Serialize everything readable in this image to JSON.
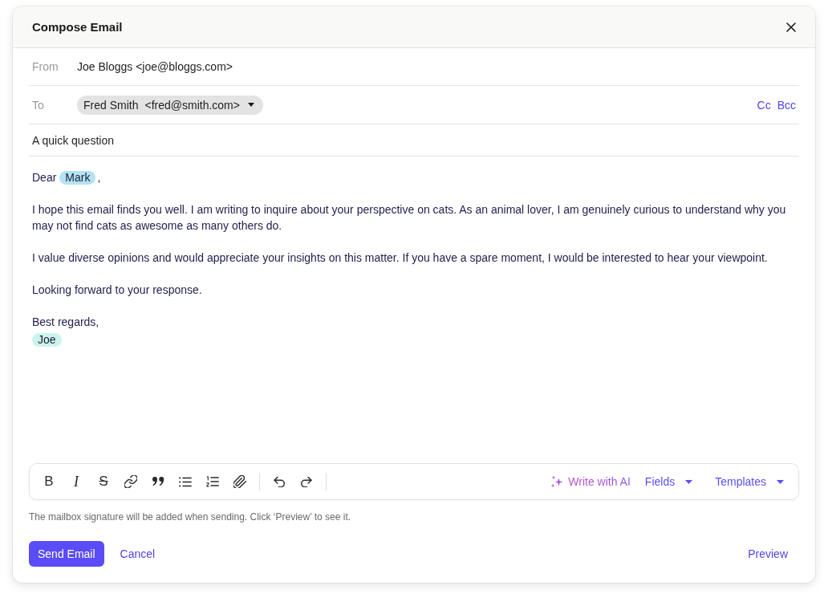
{
  "dialog": {
    "title": "Compose Email"
  },
  "from": {
    "label": "From",
    "value": "Joe Bloggs <joe@bloggs.com>"
  },
  "to": {
    "label": "To",
    "recipients": [
      {
        "name": "Fred Smith",
        "email": "<fred@smith.com>"
      }
    ],
    "links": [
      "Cc",
      "Bcc"
    ]
  },
  "subject": {
    "value": "A quick question"
  },
  "body": {
    "paragraphs": [
      {
        "lines": [
          [
            {
              "kind": "text",
              "text": "Dear"
            },
            {
              "kind": "field",
              "text": "Mark",
              "color": "#b4e3f3"
            },
            {
              "kind": "text",
              "text": ","
            }
          ]
        ]
      },
      {
        "lines": [
          [
            {
              "kind": "text",
              "text": "I hope this email finds you well. I am writing to inquire about your perspective on cats. As an animal lover, I am genuinely curious to understand why you may not find cats as awesome as many others do."
            }
          ]
        ]
      },
      {
        "lines": [
          [
            {
              "kind": "text",
              "text": "I value diverse opinions and would appreciate your insights on this matter. If you have a spare moment, I would be interested to hear your viewpoint."
            }
          ]
        ]
      },
      {
        "lines": [
          [
            {
              "kind": "text",
              "text": "Looking forward to your response."
            }
          ]
        ]
      },
      {
        "lines": [
          [
            {
              "kind": "text",
              "text": "Best regards,"
            }
          ],
          [
            {
              "kind": "field",
              "text": "Joe",
              "color": "#cbf5ec"
            }
          ]
        ]
      }
    ]
  },
  "toolbar": {
    "text_styles": [
      {
        "kind": "bold",
        "text": "B"
      },
      {
        "kind": "italic",
        "text": "I"
      },
      {
        "kind": "strike",
        "text": "S"
      }
    ],
    "ai_action": "Write with AI",
    "menus": [
      "Fields",
      "Templates"
    ]
  },
  "signature_note": "The mailbox signature will be added when sending. Click ‘Preview’ to see it.",
  "footer": {
    "primary": "Send Email",
    "secondary": "Cancel",
    "preview": "Preview"
  }
}
